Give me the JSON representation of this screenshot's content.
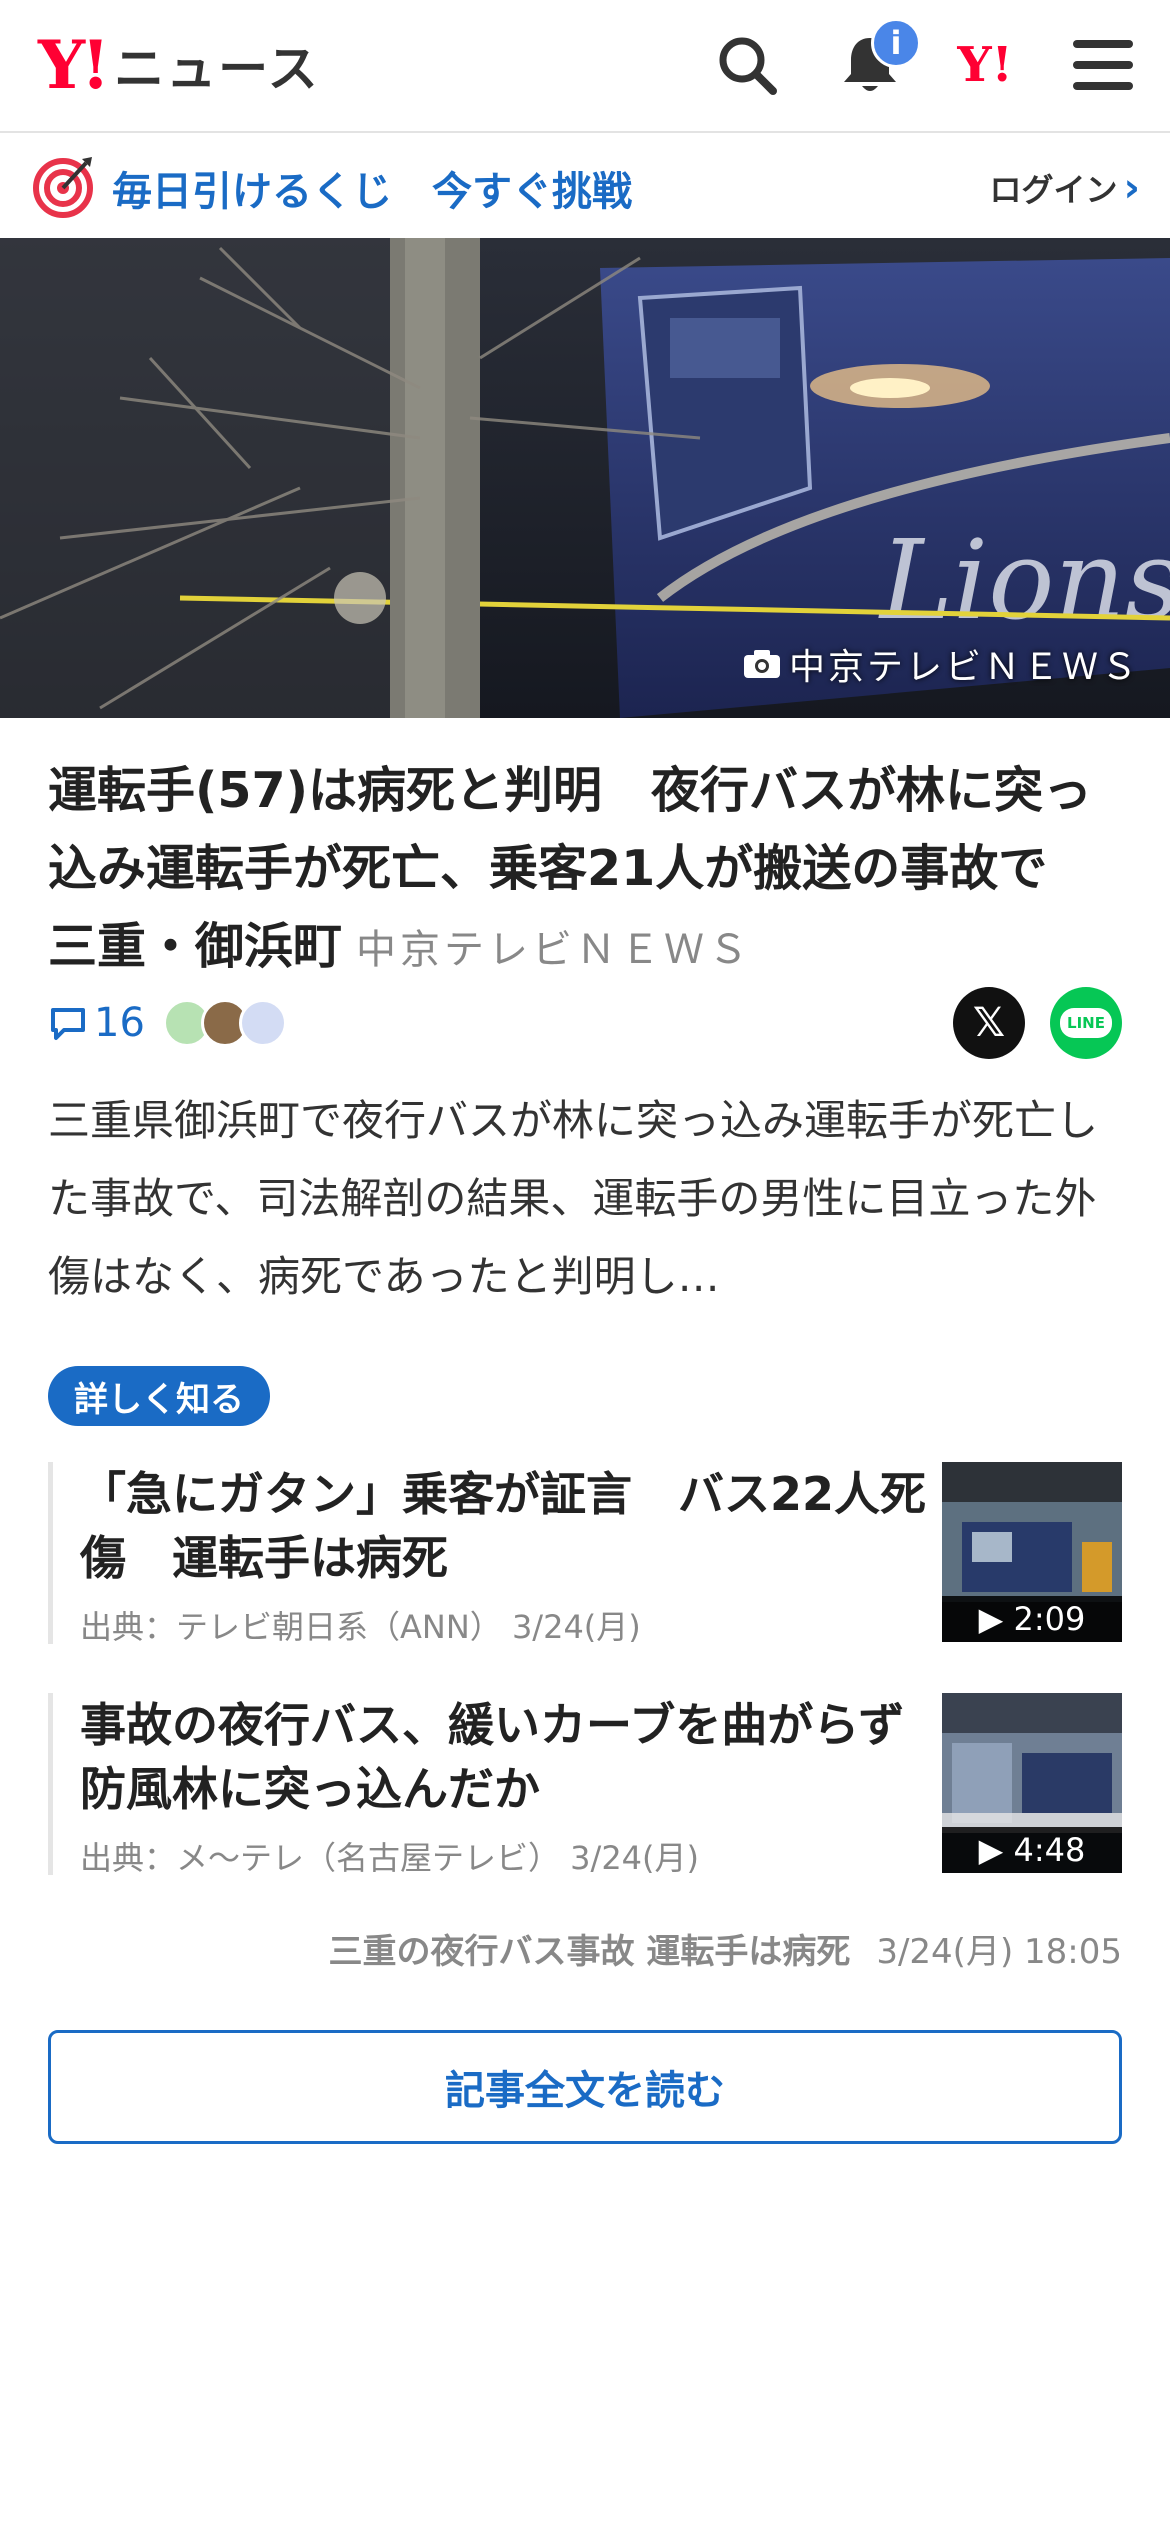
{
  "header": {
    "logo_mark": "Y!",
    "logo_text": "ニュース",
    "notification_badge": "i",
    "yahoo_mark": "Y!"
  },
  "promo": {
    "text": "毎日引けるくじ　今すぐ挑戦",
    "login": "ログイン"
  },
  "hero": {
    "credit": "中京テレビＮＥＷＳ"
  },
  "article": {
    "title": "運転手(57)は病死と判明　夜行バスが林に突っ込み運転手が死亡、乗客21人が搬送の事故で　三重・御浜町",
    "source": "中京テレビＮＥＷＳ",
    "comment_count": "16",
    "summary": "三重県御浜町で夜行バスが林に突っ込み運転手が死亡した事故で、司法解剖の結果、運転手の男性に目立った外傷はなく、病死であったと判明し…"
  },
  "share": {
    "x_label": "𝕏",
    "line_label": "LINE"
  },
  "related": {
    "pill": "詳しく知る",
    "items": [
      {
        "title": "「急にガタン」乗客が証言　バス22人死傷　運転手は病死",
        "source": "出典：テレビ朝日系（ANN） 3/24(月)",
        "duration": "▶ 2:09"
      },
      {
        "title": "事故の夜行バス、緩いカーブを曲がらず防風林に突っ込んだか",
        "source": "出典：メ～テレ（名古屋テレビ） 3/24(月)",
        "duration": "▶ 4:48"
      }
    ]
  },
  "footer": {
    "topic": "三重の夜行バス事故 運転手は病死",
    "timestamp": "3/24(月) 18:05",
    "read_full": "記事全文を読む"
  },
  "colors": {
    "brand_red": "#ff0033",
    "link_blue": "#1a6bc5",
    "line_green": "#06c755"
  }
}
